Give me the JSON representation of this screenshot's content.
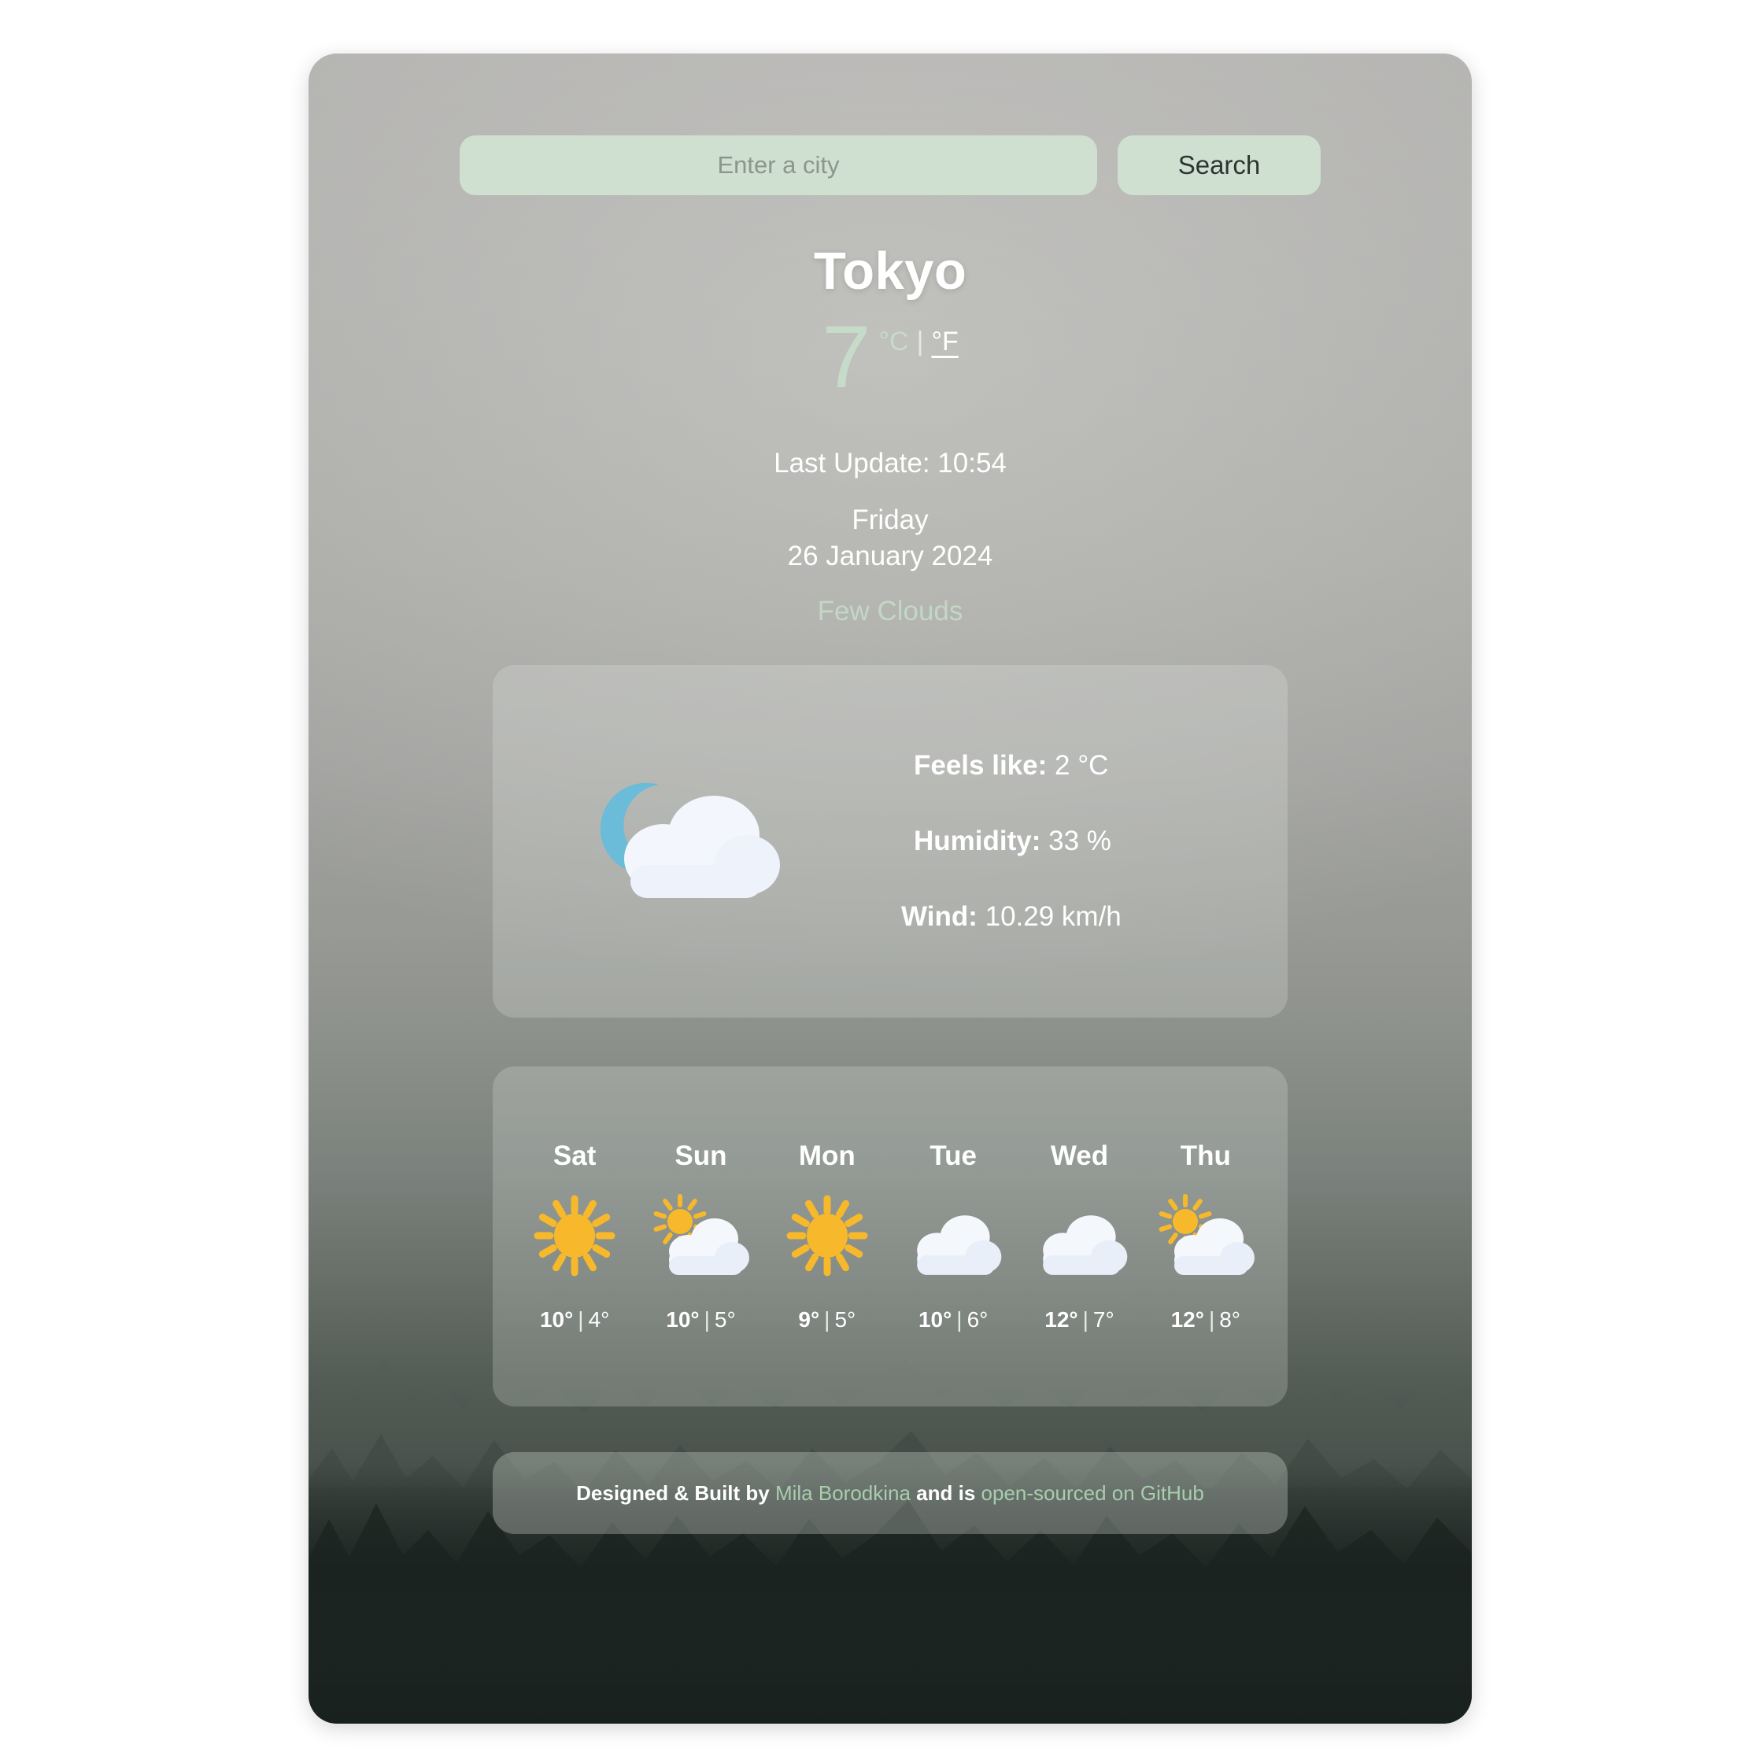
{
  "search": {
    "placeholder": "Enter a city",
    "value": "",
    "button_label": "Search"
  },
  "current": {
    "city": "Tokyo",
    "temperature": "7",
    "unit_celsius": "°C",
    "unit_separator": "|",
    "unit_fahrenheit": "°F",
    "active_unit": "celsius",
    "last_update": "Last Update: 10:54",
    "day_name": "Friday",
    "full_date": "26 January 2024",
    "condition": "Few Clouds",
    "icon": "moon-behind-cloud-icon"
  },
  "details": {
    "feels_like_label": "Feels like:",
    "feels_like_value": "2 °C",
    "humidity_label": "Humidity:",
    "humidity_value": "33 %",
    "wind_label": "Wind:",
    "wind_value": "10.29 km/h"
  },
  "forecast": [
    {
      "day": "Sat",
      "icon": "sun-icon",
      "high": "10°",
      "sep": "|",
      "low": "4°"
    },
    {
      "day": "Sun",
      "icon": "sun-behind-cloud-icon",
      "high": "10°",
      "sep": "|",
      "low": "5°"
    },
    {
      "day": "Mon",
      "icon": "sun-icon",
      "high": "9°",
      "sep": "|",
      "low": "5°"
    },
    {
      "day": "Tue",
      "icon": "cloud-icon",
      "high": "10°",
      "sep": "|",
      "low": "6°"
    },
    {
      "day": "Wed",
      "icon": "cloud-icon",
      "high": "12°",
      "sep": "|",
      "low": "7°"
    },
    {
      "day": "Thu",
      "icon": "sun-behind-cloud-icon",
      "high": "12°",
      "sep": "|",
      "low": "8°"
    }
  ],
  "footer": {
    "prefix": "Designed & Built by ",
    "author": "Mila Borodkina",
    "middle": " and is ",
    "source_link": "open-sourced on GitHub"
  },
  "colors": {
    "accent_green": "#c7dbc9",
    "input_bg": "#cfdfd0",
    "link_green": "#a9cdae",
    "sun_yellow": "#f7b92b",
    "moon_blue": "#6bbcd8",
    "cloud_white": "#f4f8fd",
    "text_white": "#ffffff"
  }
}
